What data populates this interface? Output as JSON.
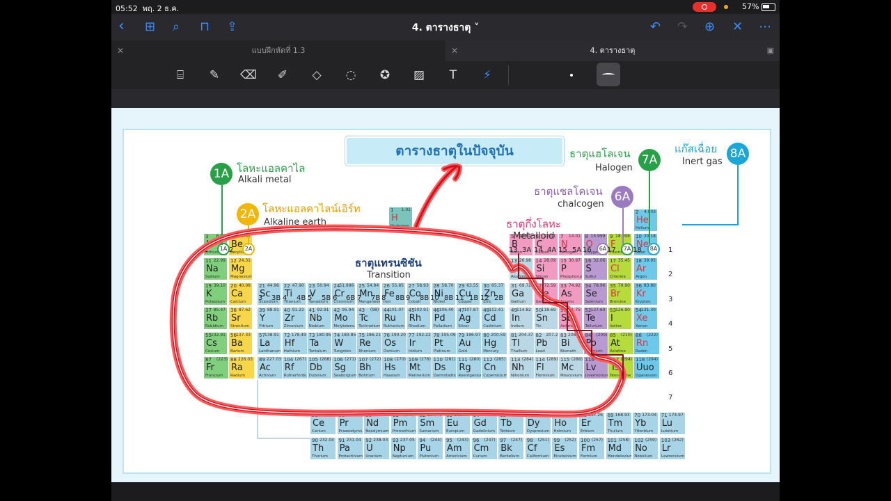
{
  "status": {
    "time": "05:52",
    "date": "พฤ. 2 ธ.ค.",
    "battery": "57%"
  },
  "nav": {
    "title": "4. ตารางธาตุ ˅"
  },
  "tabs": [
    {
      "label": "แบบฝึกหัดที่ 1.3",
      "active": false
    },
    {
      "label": "4. ตารางธาตุ",
      "active": true
    }
  ],
  "page": {
    "title": "ตารางธาตุในปัจจุบัน",
    "labels": {
      "alkali_th": "โลหะแอลคาไล",
      "alkali_en": "Alkali metal",
      "alkaline_th": "โลหะแอลคาไลน์เอิร์ท",
      "alkaline_en": "Alkaline earth",
      "transition_th": "ธาตุแทรนซิชัน",
      "transition_en": "Transition",
      "metalloid_th": "ธาตุกึ่งโลหะ",
      "metalloid_en": "Metalloid",
      "chalcogen_th": "ธาตุแชลโคเจน",
      "chalcogen_en": "chalcogen",
      "halogen_th": "ธาตุแฮโลเจน",
      "halogen_en": "Halogen",
      "inert_th": "แก๊สเฉื่อย",
      "inert_en": "Inert gas"
    },
    "badges": {
      "g1": "1A",
      "g2": "2A",
      "g6": "6A",
      "g7": "7A",
      "g8": "8A"
    },
    "group_headers": [
      "1",
      "1A",
      "2",
      "2A",
      "3",
      "3B",
      "4",
      "4B",
      "5",
      "5B",
      "6",
      "6B",
      "7",
      "7B",
      "8",
      "8B",
      "9",
      "8B",
      "10",
      "8B",
      "11",
      "1B",
      "12",
      "2B",
      "13",
      "3A",
      "14",
      "4A",
      "15",
      "5A",
      "16",
      "6A",
      "17",
      "7A",
      "18",
      "8A"
    ],
    "periods": [
      "1",
      "2",
      "3",
      "4",
      "5",
      "6",
      "7"
    ]
  },
  "elements": [
    {
      "n": "1",
      "s": "H",
      "m": "1.01",
      "nm": "Hydrogen",
      "c": "h"
    },
    {
      "n": "2",
      "s": "He",
      "m": "4.003",
      "nm": "Helium",
      "c": "nob"
    },
    {
      "n": "3",
      "s": "Li",
      "m": "6.94",
      "nm": "Lithium",
      "c": "alk"
    },
    {
      "n": "4",
      "s": "Be",
      "m": "9.01",
      "nm": "Beryllium",
      "c": "ae"
    },
    {
      "n": "5",
      "s": "B",
      "m": "10.81",
      "nm": "Boron",
      "c": "met"
    },
    {
      "n": "6",
      "s": "C",
      "m": "12.01",
      "nm": "Carbon",
      "c": "met"
    },
    {
      "n": "7",
      "s": "N",
      "m": "14.01",
      "nm": "Nitrogen",
      "c": "met"
    },
    {
      "n": "8",
      "s": "O",
      "m": "15.999",
      "nm": "Oxygen",
      "c": "chal"
    },
    {
      "n": "9",
      "s": "F",
      "m": "18.998",
      "nm": "Fluorine",
      "c": "hal"
    },
    {
      "n": "10",
      "s": "Ne",
      "m": "20.18",
      "nm": "Neon",
      "c": "nob"
    },
    {
      "n": "11",
      "s": "Na",
      "m": "22.99",
      "nm": "Sodium",
      "c": "alk"
    },
    {
      "n": "12",
      "s": "Mg",
      "m": "24.31",
      "nm": "Magnesium",
      "c": "ae"
    },
    {
      "n": "13",
      "s": "Al",
      "m": "26.98",
      "nm": "Aluminium",
      "c": "oth"
    },
    {
      "n": "14",
      "s": "Si",
      "m": "28.09",
      "nm": "Silicon",
      "c": "met"
    },
    {
      "n": "15",
      "s": "P",
      "m": "30.97",
      "nm": "Phosphorus",
      "c": "met"
    },
    {
      "n": "16",
      "s": "S",
      "m": "32.06",
      "nm": "Sulfur",
      "c": "chal"
    },
    {
      "n": "17",
      "s": "Cl",
      "m": "35.45",
      "nm": "Chlorine",
      "c": "hal"
    },
    {
      "n": "18",
      "s": "Ar",
      "m": "39.95",
      "nm": "Argon",
      "c": "nob"
    },
    {
      "n": "19",
      "s": "K",
      "m": "39.10",
      "nm": "Potassium",
      "c": "alk"
    },
    {
      "n": "20",
      "s": "Ca",
      "m": "40.08",
      "nm": "Calcium",
      "c": "ae"
    },
    {
      "n": "21",
      "s": "Sc",
      "m": "44.96",
      "nm": "Scandium",
      "c": "tr"
    },
    {
      "n": "22",
      "s": "Ti",
      "m": "47.90",
      "nm": "Titanium",
      "c": "tr"
    },
    {
      "n": "23",
      "s": "V",
      "m": "50.94",
      "nm": "Vanadium",
      "c": "tr"
    },
    {
      "n": "24",
      "s": "Cr",
      "m": "51.996",
      "nm": "Chromium",
      "c": "tr"
    },
    {
      "n": "25",
      "s": "Mn",
      "m": "54.94",
      "nm": "Manganese",
      "c": "tr"
    },
    {
      "n": "26",
      "s": "Fe",
      "m": "55.85",
      "nm": "Iron",
      "c": "tr"
    },
    {
      "n": "27",
      "s": "Co",
      "m": "58.93",
      "nm": "Cobalt",
      "c": "tr"
    },
    {
      "n": "28",
      "s": "Ni",
      "m": "58.70",
      "nm": "Nickel",
      "c": "tr"
    },
    {
      "n": "29",
      "s": "Cu",
      "m": "63.55",
      "nm": "Copper",
      "c": "tr"
    },
    {
      "n": "30",
      "s": "Zn",
      "m": "65.37",
      "nm": "Zinc",
      "c": "tr"
    },
    {
      "n": "31",
      "s": "Ga",
      "m": "69.72",
      "nm": "Gallium",
      "c": "oth"
    },
    {
      "n": "32",
      "s": "Ge",
      "m": "72.59",
      "nm": "Germanium",
      "c": "met"
    },
    {
      "n": "33",
      "s": "As",
      "m": "74.92",
      "nm": "Arsenic",
      "c": "met"
    },
    {
      "n": "34",
      "s": "Se",
      "m": "78.96",
      "nm": "Selenium",
      "c": "chal"
    },
    {
      "n": "35",
      "s": "Br",
      "m": "79.90",
      "nm": "Bromine",
      "c": "hal"
    },
    {
      "n": "36",
      "s": "Kr",
      "m": "83.80",
      "nm": "Krypton",
      "c": "nob"
    },
    {
      "n": "37",
      "s": "Rb",
      "m": "85.47",
      "nm": "Rubidium",
      "c": "alk"
    },
    {
      "n": "38",
      "s": "Sr",
      "m": "87.62",
      "nm": "Strontium",
      "c": "ae"
    },
    {
      "n": "39",
      "s": "Y",
      "m": "88.91",
      "nm": "Yttrium",
      "c": "tr"
    },
    {
      "n": "40",
      "s": "Zr",
      "m": "91.22",
      "nm": "Zirconium",
      "c": "tr"
    },
    {
      "n": "41",
      "s": "Nb",
      "m": "92.91",
      "nm": "Niobium",
      "c": "tr"
    },
    {
      "n": "42",
      "s": "Mo",
      "m": "95.94",
      "nm": "Molybdenum",
      "c": "tr"
    },
    {
      "n": "43",
      "s": "Tc",
      "m": "(98)",
      "nm": "Technetium",
      "c": "tr"
    },
    {
      "n": "44",
      "s": "Ru",
      "m": "101.07",
      "nm": "Ruthenium",
      "c": "tr"
    },
    {
      "n": "45",
      "s": "Rh",
      "m": "102.91",
      "nm": "Rhodium",
      "c": "tr"
    },
    {
      "n": "46",
      "s": "Pd",
      "m": "106.40",
      "nm": "Palladium",
      "c": "tr"
    },
    {
      "n": "47",
      "s": "Ag",
      "m": "107.87",
      "nm": "Silver",
      "c": "tr"
    },
    {
      "n": "48",
      "s": "Cd",
      "m": "112.41",
      "nm": "Cadmium",
      "c": "tr"
    },
    {
      "n": "49",
      "s": "In",
      "m": "114.82",
      "nm": "Indium",
      "c": "oth"
    },
    {
      "n": "50",
      "s": "Sn",
      "m": "118.69",
      "nm": "Tin",
      "c": "oth"
    },
    {
      "n": "51",
      "s": "Sb",
      "m": "121.75",
      "nm": "Antimony",
      "c": "met"
    },
    {
      "n": "52",
      "s": "Te",
      "m": "127.60",
      "nm": "Tellurium",
      "c": "chal"
    },
    {
      "n": "53",
      "s": "I",
      "m": "126.90",
      "nm": "Iodine",
      "c": "hal"
    },
    {
      "n": "54",
      "s": "Xe",
      "m": "131.30",
      "nm": "Xenon",
      "c": "nob"
    },
    {
      "n": "55",
      "s": "Cs",
      "m": "132.91",
      "nm": "Cesium",
      "c": "alk"
    },
    {
      "n": "56",
      "s": "Ba",
      "m": "137.33",
      "nm": "Barium",
      "c": "ae"
    },
    {
      "n": "57",
      "s": "La",
      "m": "138.91",
      "nm": "Lanthanum",
      "c": "tr"
    },
    {
      "n": "72",
      "s": "Hf",
      "m": "178.49",
      "nm": "Hafnium",
      "c": "tr"
    },
    {
      "n": "73",
      "s": "Ta",
      "m": "180.95",
      "nm": "Tantalum",
      "c": "tr"
    },
    {
      "n": "74",
      "s": "W",
      "m": "183.85",
      "nm": "Tungsten",
      "c": "tr"
    },
    {
      "n": "75",
      "s": "Re",
      "m": "186.21",
      "nm": "Rhenium",
      "c": "tr"
    },
    {
      "n": "76",
      "s": "Os",
      "m": "190.20",
      "nm": "Osmium",
      "c": "tr"
    },
    {
      "n": "77",
      "s": "Ir",
      "m": "192.22",
      "nm": "Iridium",
      "c": "tr"
    },
    {
      "n": "78",
      "s": "Pt",
      "m": "195.09",
      "nm": "Platinum",
      "c": "tr"
    },
    {
      "n": "79",
      "s": "Au",
      "m": "196.97",
      "nm": "Gold",
      "c": "tr"
    },
    {
      "n": "80",
      "s": "Hg",
      "m": "200.59",
      "nm": "Mercury",
      "c": "tr"
    },
    {
      "n": "81",
      "s": "Tl",
      "m": "204.37",
      "nm": "Thallium",
      "c": "oth"
    },
    {
      "n": "82",
      "s": "Pb",
      "m": "207.2",
      "nm": "Lead",
      "c": "oth"
    },
    {
      "n": "83",
      "s": "Bi",
      "m": "208.98",
      "nm": "Bismuth",
      "c": "oth"
    },
    {
      "n": "84",
      "s": "Po",
      "m": "(209)",
      "nm": "Polonium",
      "c": "chal"
    },
    {
      "n": "85",
      "s": "At",
      "m": "(210)",
      "nm": "Astatine",
      "c": "hal"
    },
    {
      "n": "86",
      "s": "Rn",
      "m": "(222)",
      "nm": "Radon",
      "c": "nob"
    },
    {
      "n": "87",
      "s": "Fr",
      "m": "(223)",
      "nm": "Francium",
      "c": "alk"
    },
    {
      "n": "88",
      "s": "Ra",
      "m": "226.03",
      "nm": "Radium",
      "c": "ae"
    },
    {
      "n": "89",
      "s": "Ac",
      "m": "227.03",
      "nm": "Actinium",
      "c": "tr"
    },
    {
      "n": "104",
      "s": "Rf",
      "m": "(267)",
      "nm": "Rutherfordium",
      "c": "tr"
    },
    {
      "n": "105",
      "s": "Db",
      "m": "(268)",
      "nm": "Dubnium",
      "c": "tr"
    },
    {
      "n": "106",
      "s": "Sg",
      "m": "(271)",
      "nm": "Seaborgium",
      "c": "tr"
    },
    {
      "n": "107",
      "s": "Bh",
      "m": "(272)",
      "nm": "Bohrium",
      "c": "tr"
    },
    {
      "n": "108",
      "s": "Hs",
      "m": "(270)",
      "nm": "Hassium",
      "c": "tr"
    },
    {
      "n": "109",
      "s": "Mt",
      "m": "(276)",
      "nm": "Meitnerium",
      "c": "tr"
    },
    {
      "n": "110",
      "s": "Ds",
      "m": "(281)",
      "nm": "Darmstadtium",
      "c": "tr"
    },
    {
      "n": "111",
      "s": "Rg",
      "m": "(280)",
      "nm": "Roentgenium",
      "c": "tr"
    },
    {
      "n": "112",
      "s": "Cn",
      "m": "(285)",
      "nm": "Copernicium",
      "c": "tr"
    },
    {
      "n": "113",
      "s": "Nh",
      "m": "(284)",
      "nm": "Nihonium",
      "c": "oth"
    },
    {
      "n": "114",
      "s": "Fl",
      "m": "(289)",
      "nm": "Flerovium",
      "c": "oth"
    },
    {
      "n": "115",
      "s": "Mc",
      "m": "(288)",
      "nm": "Moscovium",
      "c": "oth"
    },
    {
      "n": "116",
      "s": "Lv",
      "m": "(293)",
      "nm": "Livermorium",
      "c": "chal"
    },
    {
      "n": "117",
      "s": "Ts",
      "m": "(294)",
      "nm": "Tennessine",
      "c": "hal"
    },
    {
      "n": "118",
      "s": "Uuo",
      "m": "(294)",
      "nm": "Oganesson",
      "c": "nob"
    },
    {
      "n": "58",
      "s": "Ce",
      "m": "140.12",
      "nm": "Cerium",
      "c": "lan"
    },
    {
      "n": "59",
      "s": "Pr",
      "m": "140.91",
      "nm": "Praseodymium",
      "c": "lan"
    },
    {
      "n": "60",
      "s": "Nd",
      "m": "144.24",
      "nm": "Neodymium",
      "c": "lan"
    },
    {
      "n": "61",
      "s": "Pm",
      "m": "(145)",
      "nm": "Promethium",
      "c": "lan"
    },
    {
      "n": "62",
      "s": "Sm",
      "m": "150.40",
      "nm": "Samarium",
      "c": "lan"
    },
    {
      "n": "63",
      "s": "Eu",
      "m": "151.96",
      "nm": "Europium",
      "c": "lan"
    },
    {
      "n": "64",
      "s": "Gd",
      "m": "157.25",
      "nm": "Gadolinium",
      "c": "lan"
    },
    {
      "n": "65",
      "s": "Tb",
      "m": "158.93",
      "nm": "Terbium",
      "c": "lan"
    },
    {
      "n": "66",
      "s": "Dy",
      "m": "162.50",
      "nm": "Dysprosium",
      "c": "lan"
    },
    {
      "n": "67",
      "s": "Ho",
      "m": "164.93",
      "nm": "Holmium",
      "c": "lan"
    },
    {
      "n": "68",
      "s": "Er",
      "m": "167.26",
      "nm": "Erbium",
      "c": "lan"
    },
    {
      "n": "69",
      "s": "Tm",
      "m": "168.93",
      "nm": "Thulium",
      "c": "lan"
    },
    {
      "n": "70",
      "s": "Yb",
      "m": "173.04",
      "nm": "Ytterbium",
      "c": "lan"
    },
    {
      "n": "71",
      "s": "Lu",
      "m": "174.97",
      "nm": "Lutetium",
      "c": "lan"
    },
    {
      "n": "90",
      "s": "Th",
      "m": "232.04",
      "nm": "Thorium",
      "c": "lan"
    },
    {
      "n": "91",
      "s": "Pa",
      "m": "231.04",
      "nm": "Protactinium",
      "c": "lan"
    },
    {
      "n": "92",
      "s": "U",
      "m": "238.03",
      "nm": "Uranium",
      "c": "lan"
    },
    {
      "n": "93",
      "s": "Np",
      "m": "237.05",
      "nm": "Neptunium",
      "c": "lan"
    },
    {
      "n": "94",
      "s": "Pu",
      "m": "(244)",
      "nm": "Plutonium",
      "c": "lan"
    },
    {
      "n": "95",
      "s": "Am",
      "m": "(243)",
      "nm": "Americium",
      "c": "lan"
    },
    {
      "n": "96",
      "s": "Cm",
      "m": "(247)",
      "nm": "Curium",
      "c": "lan"
    },
    {
      "n": "97",
      "s": "Bk",
      "m": "(247)",
      "nm": "Berkelium",
      "c": "lan"
    },
    {
      "n": "98",
      "s": "Cf",
      "m": "(251)",
      "nm": "Californium",
      "c": "lan"
    },
    {
      "n": "99",
      "s": "Es",
      "m": "(252)",
      "nm": "Einsteinium",
      "c": "lan"
    },
    {
      "n": "100",
      "s": "Fm",
      "m": "(257)",
      "nm": "Fermium",
      "c": "lan"
    },
    {
      "n": "101",
      "s": "Md",
      "m": "(258)",
      "nm": "Mendelevium",
      "c": "lan"
    },
    {
      "n": "102",
      "s": "No",
      "m": "(259)",
      "nm": "Nobelium",
      "c": "lan"
    },
    {
      "n": "103",
      "s": "Lr",
      "m": "(262)",
      "nm": "Lawrencium",
      "c": "lan"
    }
  ]
}
